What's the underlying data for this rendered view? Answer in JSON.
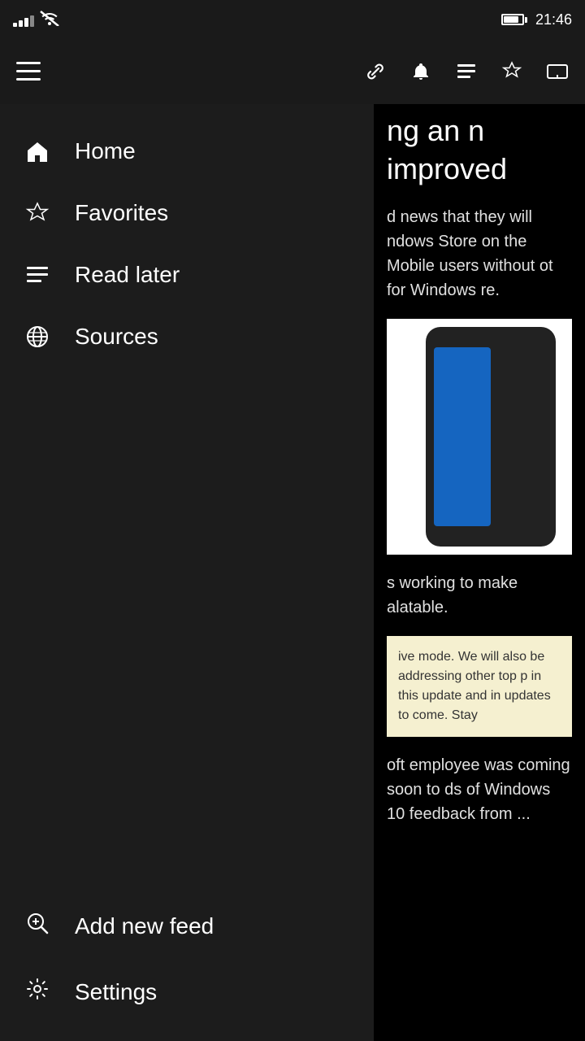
{
  "statusBar": {
    "time": "21:46",
    "batteryLevel": 80
  },
  "toolbar": {
    "menuIcon": "☰",
    "linkIcon": "link",
    "notifIcon": "bell",
    "listIcon": "list",
    "starIcon": "★",
    "castIcon": "cast"
  },
  "sidebar": {
    "navItems": [
      {
        "id": "home",
        "label": "Home",
        "icon": "home"
      },
      {
        "id": "favorites",
        "label": "Favorites",
        "icon": "star"
      },
      {
        "id": "read-later",
        "label": "Read later",
        "icon": "read-later"
      },
      {
        "id": "sources",
        "label": "Sources",
        "icon": "globe"
      }
    ],
    "bottomItems": [
      {
        "id": "add-feed",
        "label": "Add new feed",
        "icon": "add-search"
      },
      {
        "id": "settings",
        "label": "Settings",
        "icon": "gear"
      }
    ]
  },
  "article": {
    "titlePartial": "ng an\nn improved",
    "bodyText1": "d news that they will\nndows Store on the\nMobile users without\not for Windows\nre.",
    "bodyText2": "s working to make\nalatable.",
    "snippetText": "ive mode. We will also be addressing other top\np in this update and in updates to come. Stay",
    "bodyText3": "oft employee\nwas coming soon to\nds of Windows 10\nfeedback from\n..."
  }
}
